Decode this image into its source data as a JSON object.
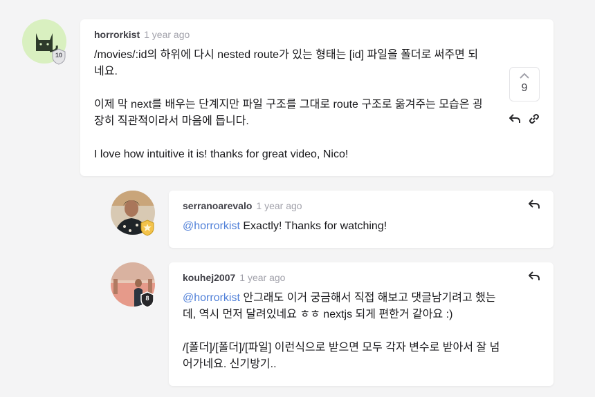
{
  "comments": [
    {
      "user": "horrorkist",
      "time": "1 year ago",
      "line1": "/movies/:id의 하위에 다시 nested route가 있는 형태는 [id] 파일을 폴더로 써주면 되",
      "line2": "네요.",
      "line3": "이제 막 next를 배우는 단계지만 파일 구조를 그대로 route 구조로 옮겨주는 모습은 굉",
      "line4": "장히 직관적이라서 마음에 듭니다.",
      "line5": "I love how intuitive it is! thanks for great video, Nico!",
      "votes": "9",
      "badge_level": "10"
    },
    {
      "user": "serranoarevalo",
      "time": "1 year ago",
      "mention": "@horrorkist",
      "text": " Exactly! Thanks for watching!"
    },
    {
      "user": "kouhej2007",
      "time": "1 year ago",
      "mention": "@horrorkist",
      "line1_rest": " 안그래도 이거 궁금해서 직접 해보고 댓글남기려고 했는",
      "line2": "데, 역시 먼저 달려있네요 ㅎㅎ nextjs 되게 편한거 같아요 :)",
      "line3": "/[폴더]/[폴더]/[파일] 이런식으로 받으면 모두 각자 변수로 받아서 잘 넘",
      "line4": "어가네요. 신기방기..",
      "badge_level": "8"
    }
  ],
  "colors": {
    "mention": "#4f7fd8",
    "avatar1_bg": "#d9f0c0"
  }
}
